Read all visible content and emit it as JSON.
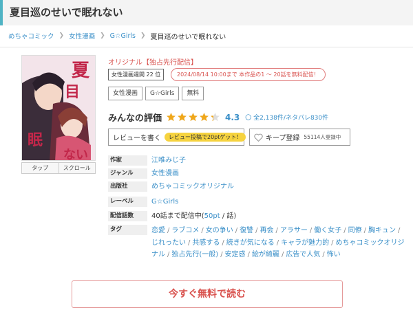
{
  "page": {
    "title": "夏目巡のせいで眠れない"
  },
  "breadcrumb": {
    "items": [
      "めちゃコミック",
      "女性漫画",
      "G☆Girls"
    ],
    "current": "夏目巡のせいで眠れない"
  },
  "cover": {
    "tap_label": "タップ",
    "scroll_label": "スクロール"
  },
  "header": {
    "original_label": "オリジナル【独占先行配信】",
    "rank_text": "女性漫画週間 22 位",
    "free_campaign": "2024/08/14 10:00まで 本作品の1 ～ 20話を無料配信！",
    "genre_tags": [
      "女性漫画",
      "G☆Girls",
      "無料"
    ]
  },
  "rating": {
    "label": "みんなの評価",
    "value": "4.3",
    "value_number": 4.3,
    "review_count": "〇 全2,138件/ネタバレ830件",
    "star_color": "#f0a71a",
    "star_empty_color": "#dddddd"
  },
  "actions": {
    "review_label": "レビューを書く",
    "review_pill": "レビュー投稿で20ptゲット！",
    "keep_label": "キープ登録",
    "keep_count": "55114人登録中"
  },
  "info": {
    "author_label": "作家",
    "author": "江唯みじ子",
    "genre_label": "ジャンル",
    "genre": "女性漫画",
    "publisher_label": "出版社",
    "publisher": "めちゃコミックオリジナル",
    "label_label": "レーベル",
    "label": "G☆Girls",
    "episodes_label": "配信話数",
    "episodes_prefix": "40話まで配信中(",
    "episodes_price": "50pt",
    "episodes_suffix": " / 話)",
    "tags_label": "タグ",
    "tags": [
      "恋愛",
      "ラブコメ",
      "女の争い",
      "復讐",
      "再会",
      "アラサー",
      "働く女子",
      "同僚",
      "胸キュン",
      "じれったい",
      "共感する",
      "続きが気になる",
      "キャラが魅力的",
      "めちゃコミックオリジナル",
      "独占先行(一般)",
      "安定感",
      "絵が綺麗",
      "広告で人気",
      "怖い"
    ]
  },
  "cta": {
    "label": "今すぐ無料で読む"
  },
  "colors": {
    "accent": "#3a8fc8",
    "title_bar_accent": "#4fb3c4",
    "cta_red": "#d9534f"
  }
}
